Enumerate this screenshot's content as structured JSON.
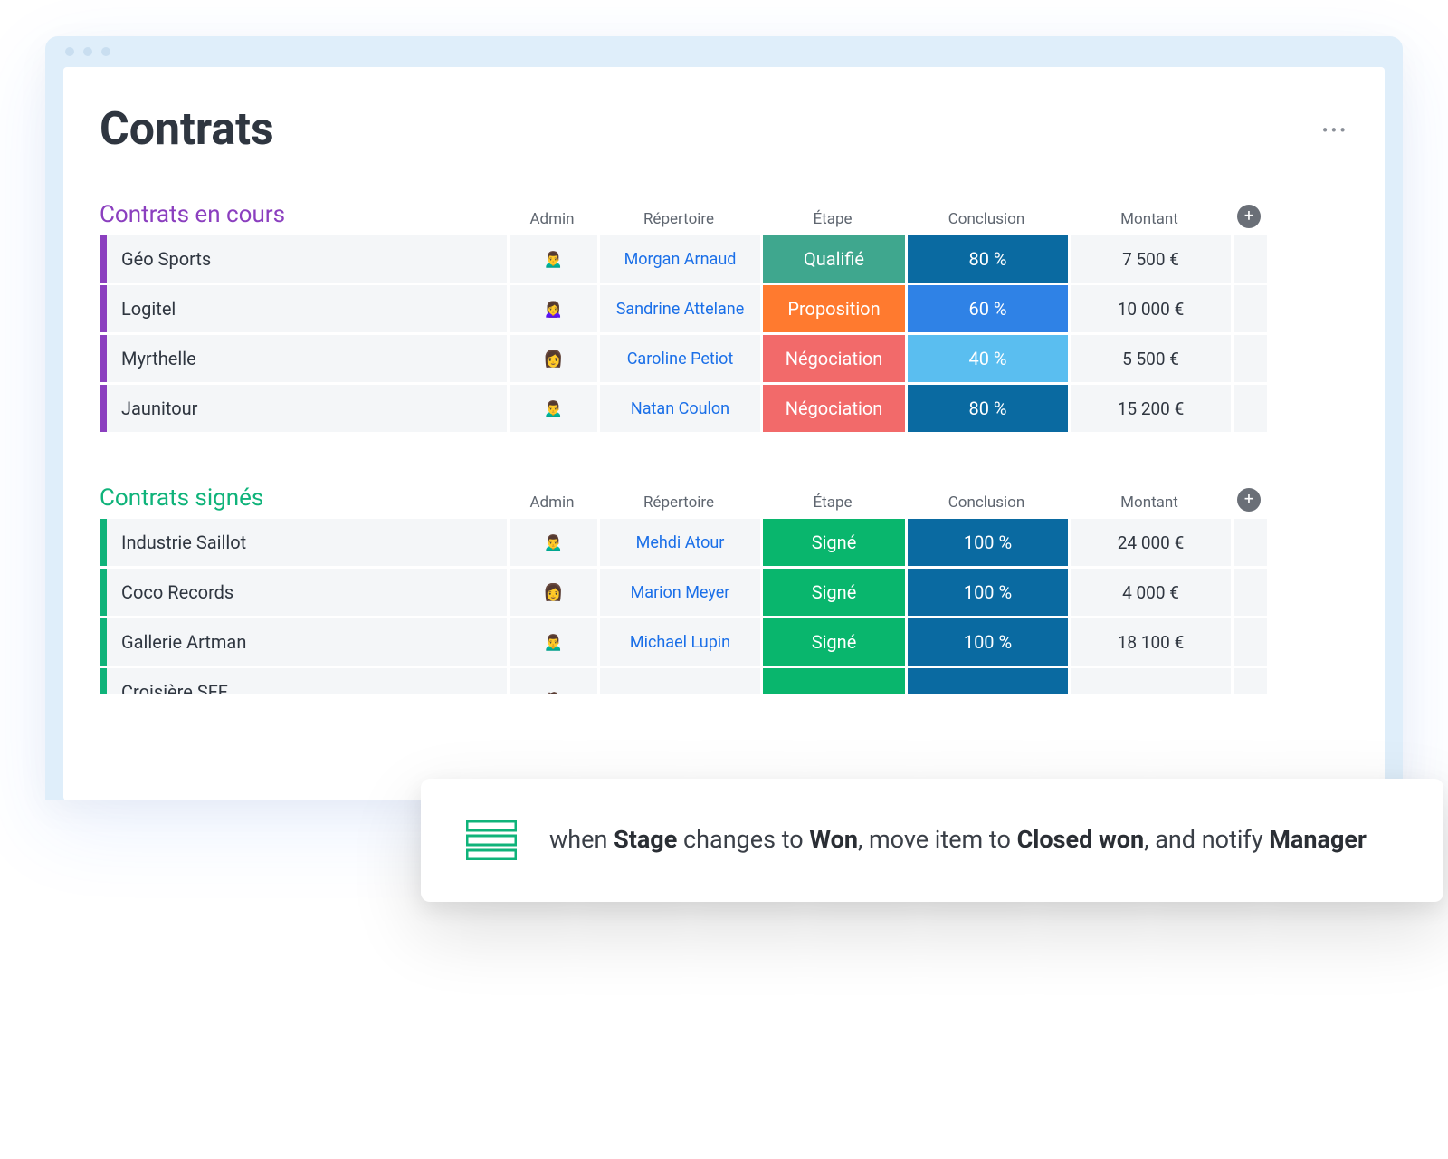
{
  "page": {
    "title": "Contrats"
  },
  "columns": {
    "admin": "Admin",
    "directory": "Répertoire",
    "stage": "Étape",
    "conclusion": "Conclusion",
    "amount": "Montant"
  },
  "groups": [
    {
      "title": "Contrats en cours",
      "color": "purple",
      "rows": [
        {
          "name": "Géo Sports",
          "avatar_bg": "#e9d7c7",
          "directory": "Morgan Arnaud",
          "stage": "Qualifié",
          "stage_color": "bg-teal",
          "conclusion": "80 %",
          "conc_color": "bg-blue-d",
          "amount": "7 500 €"
        },
        {
          "name": "Logitel",
          "avatar_bg": "#d9d2cc",
          "directory": "Sandrine Attelane",
          "stage": "Proposition",
          "stage_color": "bg-orange",
          "conclusion": "60 %",
          "conc_color": "bg-blue-m",
          "amount": "10 000 €"
        },
        {
          "name": "Myrthelle",
          "avatar_bg": "#e2c7a8",
          "directory": "Caroline Petiot",
          "stage": "Négociation",
          "stage_color": "bg-coral",
          "conclusion": "40 %",
          "conc_color": "bg-blue-l",
          "amount": "5 500 €"
        },
        {
          "name": "Jaunitour",
          "avatar_bg": "#dfe3e8",
          "directory": "Natan Coulon",
          "stage": "Négociation",
          "stage_color": "bg-coral",
          "conclusion": "80 %",
          "conc_color": "bg-blue-d",
          "amount": "15 200 €"
        }
      ]
    },
    {
      "title": "Contrats signés",
      "color": "green",
      "rows": [
        {
          "name": "Industrie Saillot",
          "avatar_bg": "#d7cfc6",
          "directory": "Mehdi Atour",
          "stage": "Signé",
          "stage_color": "bg-green",
          "conclusion": "100 %",
          "conc_color": "bg-blue-d",
          "amount": "24 000 €"
        },
        {
          "name": "Coco Records",
          "avatar_bg": "#e8d3c3",
          "directory": "Marion Meyer",
          "stage": "Signé",
          "stage_color": "bg-green",
          "conclusion": "100 %",
          "conc_color": "bg-blue-d",
          "amount": "4 000 €"
        },
        {
          "name": "Gallerie Artman",
          "avatar_bg": "#e0d6cc",
          "directory": "Michael Lupin",
          "stage": "Signé",
          "stage_color": "bg-green",
          "conclusion": "100 %",
          "conc_color": "bg-blue-d",
          "amount": "18 100 €"
        },
        {
          "name": "Croisière SFF",
          "avatar_bg": "#e6e6e6",
          "directory": "",
          "stage": "",
          "stage_color": "bg-green",
          "conclusion": "",
          "conc_color": "bg-blue-d",
          "amount": ""
        }
      ]
    }
  ],
  "automation": {
    "prefix": "when ",
    "var1": "Stage",
    "mid1": " changes to ",
    "var2": "Won",
    "mid2": ", move item to ",
    "var3": "Closed won",
    "mid3": ", and notify ",
    "var4": "Manager"
  }
}
